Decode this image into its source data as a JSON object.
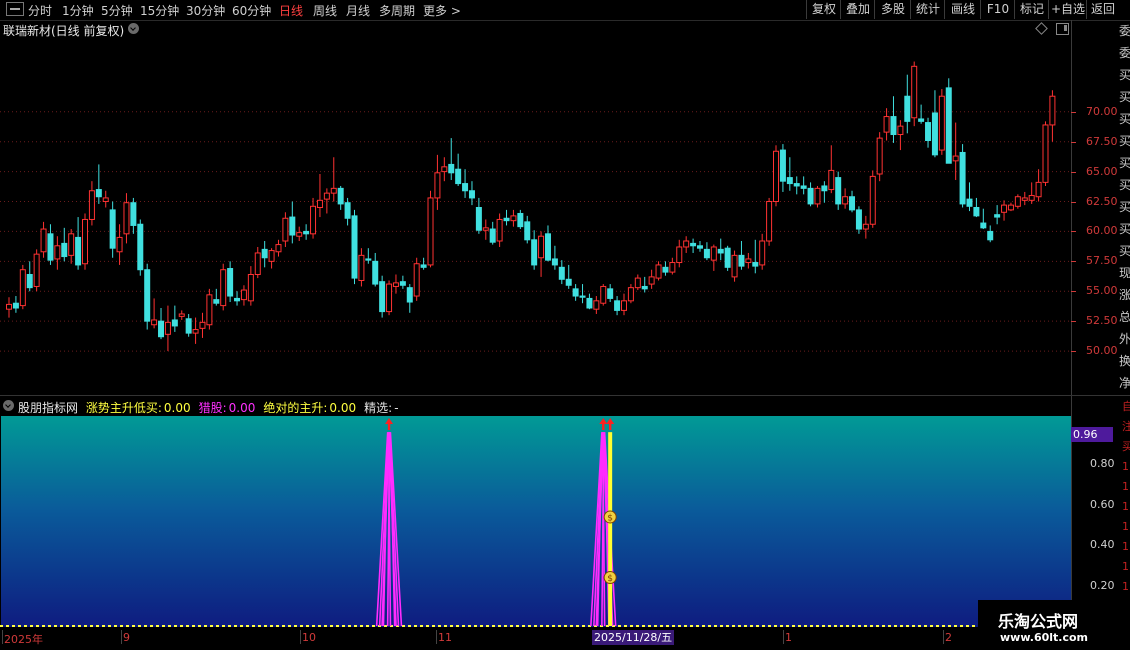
{
  "toolbar": {
    "periods": [
      "分时",
      "1分钟",
      "5分钟",
      "15分钟",
      "30分钟",
      "60分钟",
      "日线",
      "周线",
      "月线",
      "多周期",
      "更多 >"
    ],
    "active_period": "日线",
    "right_buttons": [
      "复权",
      "叠加",
      "多股",
      "统计",
      "画线",
      "F10",
      "标记",
      "+自选",
      "返回"
    ]
  },
  "stock": {
    "title": "联瑞新材(日线 前复权)"
  },
  "price_axis": {
    "labels": [
      "70.00",
      "67.50",
      "65.00",
      "62.50",
      "60.00",
      "57.50",
      "55.00",
      "52.50",
      "50.00"
    ]
  },
  "indicator": {
    "name": "股朋指标网",
    "fields": [
      {
        "label": "涨势主升低买:",
        "value": "0.00",
        "color": "#ffff40"
      },
      {
        "label": "猎股:",
        "value": "0.00",
        "color": "#ff30ff"
      },
      {
        "label": "绝对的主升:",
        "value": "0.00",
        "color": "#ffff40"
      },
      {
        "label": "精选:",
        "value": "-",
        "color": "#e0e0e0"
      }
    ],
    "axis_labels": [
      "0.80",
      "0.60",
      "0.40",
      "0.20"
    ],
    "current_value": "0.96"
  },
  "sidebar_chars": [
    "委",
    "委",
    "买",
    "买",
    "买",
    "买",
    "买",
    "买",
    "买",
    "买",
    "买",
    "现",
    "涨",
    "总",
    "外",
    "换",
    "净"
  ],
  "right_red_chars": [
    "自",
    "注",
    "买",
    "1",
    "1",
    "1",
    "1",
    "1",
    "1",
    "1"
  ],
  "x_axis": {
    "labels": [
      "2025年",
      "9",
      "10",
      "11",
      "1",
      "2"
    ],
    "current_date": "2025/11/28/五"
  },
  "watermark": {
    "line1": "乐淘公式网",
    "line2": "www.60lt.com"
  },
  "chart_data": {
    "type": "candlestick",
    "ylim": [
      48,
      76
    ],
    "up_color": "#ff3232",
    "down_color": "#40e0e0",
    "candles": [
      [
        53.5,
        54.5,
        52.8,
        53.9
      ],
      [
        54.0,
        54.6,
        53.2,
        53.6
      ],
      [
        53.8,
        57.2,
        53.5,
        56.8
      ],
      [
        56.4,
        57.5,
        55.0,
        55.3
      ],
      [
        55.4,
        58.5,
        55.0,
        58.1
      ],
      [
        58.3,
        60.8,
        57.8,
        60.2
      ],
      [
        59.8,
        60.6,
        57.2,
        57.6
      ],
      [
        57.7,
        59.6,
        56.8,
        58.8
      ],
      [
        59.0,
        60.3,
        57.5,
        57.9
      ],
      [
        58.0,
        60.2,
        57.3,
        59.8
      ],
      [
        59.5,
        61.2,
        56.8,
        57.2
      ],
      [
        57.3,
        61.5,
        56.8,
        61.0
      ],
      [
        61.0,
        64.2,
        60.5,
        63.4
      ],
      [
        63.5,
        65.6,
        62.3,
        62.9
      ],
      [
        62.5,
        63.4,
        62.0,
        62.8
      ],
      [
        61.8,
        62.5,
        57.8,
        58.6
      ],
      [
        58.3,
        60.6,
        57.2,
        59.5
      ],
      [
        59.8,
        63.2,
        59.0,
        62.4
      ],
      [
        62.4,
        62.8,
        59.8,
        60.5
      ],
      [
        60.6,
        61.0,
        56.3,
        56.8
      ],
      [
        56.8,
        57.3,
        51.8,
        52.5
      ],
      [
        52.2,
        54.4,
        51.9,
        52.6
      ],
      [
        52.5,
        53.6,
        51.0,
        51.2
      ],
      [
        51.4,
        53.8,
        50.0,
        52.4
      ],
      [
        52.6,
        53.8,
        51.6,
        52.1
      ],
      [
        52.9,
        53.4,
        52.6,
        53.1
      ],
      [
        52.7,
        53.1,
        51.2,
        51.5
      ],
      [
        51.5,
        52.8,
        50.6,
        51.8
      ],
      [
        51.9,
        53.2,
        51.1,
        52.4
      ],
      [
        52.2,
        55.2,
        51.8,
        54.7
      ],
      [
        54.3,
        55.2,
        53.8,
        54.0
      ],
      [
        53.8,
        57.3,
        53.4,
        56.8
      ],
      [
        56.9,
        57.5,
        54.1,
        54.6
      ],
      [
        54.4,
        55.0,
        53.8,
        54.2
      ],
      [
        54.3,
        55.5,
        53.8,
        55.1
      ],
      [
        54.2,
        57.1,
        53.8,
        56.4
      ],
      [
        56.4,
        58.7,
        56.1,
        58.2
      ],
      [
        58.5,
        59.2,
        57.0,
        57.8
      ],
      [
        57.5,
        58.6,
        56.9,
        58.4
      ],
      [
        58.3,
        59.3,
        57.9,
        58.9
      ],
      [
        59.2,
        61.6,
        58.7,
        61.1
      ],
      [
        61.2,
        62.5,
        59.0,
        59.7
      ],
      [
        59.6,
        60.4,
        59.2,
        59.9
      ],
      [
        60.0,
        60.6,
        59.3,
        59.8
      ],
      [
        59.8,
        62.8,
        59.4,
        62.1
      ],
      [
        62.0,
        64.8,
        61.2,
        62.6
      ],
      [
        62.7,
        63.6,
        61.5,
        63.2
      ],
      [
        63.2,
        66.2,
        62.5,
        63.6
      ],
      [
        63.6,
        63.8,
        61.8,
        62.3
      ],
      [
        62.4,
        62.8,
        60.5,
        61.1
      ],
      [
        61.3,
        61.8,
        55.6,
        56.1
      ],
      [
        55.9,
        58.6,
        55.4,
        58.0
      ],
      [
        57.7,
        58.6,
        57.3,
        57.6
      ],
      [
        57.5,
        58.2,
        55.4,
        55.6
      ],
      [
        55.8,
        56.3,
        52.8,
        53.3
      ],
      [
        53.3,
        55.9,
        53.0,
        55.6
      ],
      [
        55.4,
        56.4,
        54.8,
        55.7
      ],
      [
        55.8,
        56.3,
        55.2,
        55.5
      ],
      [
        55.3,
        55.6,
        53.2,
        54.1
      ],
      [
        54.6,
        57.8,
        54.2,
        57.3
      ],
      [
        57.2,
        57.8,
        56.8,
        57.0
      ],
      [
        57.2,
        63.4,
        57.0,
        62.8
      ],
      [
        62.8,
        66.4,
        61.8,
        64.9
      ],
      [
        65.0,
        66.2,
        64.2,
        65.4
      ],
      [
        65.6,
        67.8,
        64.3,
        64.9
      ],
      [
        65.2,
        66.5,
        63.8,
        64.0
      ],
      [
        64.0,
        65.2,
        62.8,
        63.4
      ],
      [
        63.4,
        64.2,
        62.2,
        62.8
      ],
      [
        62.0,
        62.8,
        59.8,
        60.1
      ],
      [
        60.1,
        61.0,
        59.3,
        60.3
      ],
      [
        60.2,
        60.8,
        58.9,
        59.1
      ],
      [
        59.2,
        61.5,
        58.7,
        61.0
      ],
      [
        61.1,
        61.8,
        60.5,
        60.9
      ],
      [
        60.9,
        61.8,
        60.4,
        61.3
      ],
      [
        61.5,
        61.8,
        60.2,
        60.4
      ],
      [
        60.8,
        61.3,
        59.0,
        59.3
      ],
      [
        59.3,
        60.1,
        56.8,
        57.2
      ],
      [
        57.8,
        60.0,
        56.2,
        59.6
      ],
      [
        59.8,
        60.5,
        57.5,
        57.6
      ],
      [
        57.7,
        58.8,
        56.8,
        57.2
      ],
      [
        57.0,
        57.6,
        55.6,
        56.0
      ],
      [
        56.0,
        57.2,
        55.2,
        55.5
      ],
      [
        55.2,
        55.6,
        54.2,
        54.6
      ],
      [
        54.6,
        55.6,
        54.0,
        54.5
      ],
      [
        54.4,
        54.8,
        53.5,
        53.6
      ],
      [
        53.5,
        54.6,
        53.1,
        54.2
      ],
      [
        54.0,
        55.6,
        53.8,
        55.4
      ],
      [
        55.2,
        55.6,
        54.1,
        54.4
      ],
      [
        54.2,
        54.6,
        53.0,
        53.4
      ],
      [
        53.4,
        54.8,
        53.0,
        54.2
      ],
      [
        54.2,
        55.6,
        54.0,
        55.3
      ],
      [
        55.3,
        56.4,
        55.1,
        56.1
      ],
      [
        55.4,
        56.2,
        54.9,
        55.2
      ],
      [
        55.6,
        56.8,
        55.2,
        56.2
      ],
      [
        56.1,
        57.5,
        55.9,
        57.2
      ],
      [
        57.0,
        57.5,
        56.3,
        56.6
      ],
      [
        56.6,
        57.8,
        56.4,
        57.4
      ],
      [
        57.4,
        59.3,
        57.0,
        58.7
      ],
      [
        58.7,
        59.6,
        58.2,
        59.2
      ],
      [
        59.0,
        59.4,
        58.2,
        58.8
      ],
      [
        58.8,
        59.2,
        58.3,
        58.6
      ],
      [
        58.5,
        59.1,
        57.6,
        57.8
      ],
      [
        57.6,
        58.9,
        56.7,
        58.7
      ],
      [
        58.5,
        59.4,
        57.6,
        58.2
      ],
      [
        58.6,
        58.8,
        56.7,
        57.0
      ],
      [
        56.2,
        58.4,
        55.8,
        58.0
      ],
      [
        58.0,
        59.2,
        56.8,
        57.1
      ],
      [
        57.4,
        58.2,
        56.9,
        57.7
      ],
      [
        57.4,
        59.3,
        56.5,
        57.1
      ],
      [
        57.2,
        59.8,
        56.8,
        59.2
      ],
      [
        59.2,
        62.8,
        58.8,
        62.5
      ],
      [
        62.5,
        67.2,
        62.1,
        66.7
      ],
      [
        66.8,
        67.3,
        63.3,
        64.2
      ],
      [
        64.5,
        66.2,
        63.4,
        64.0
      ],
      [
        64.0,
        64.6,
        63.1,
        63.8
      ],
      [
        63.8,
        64.6,
        63.1,
        63.6
      ],
      [
        63.6,
        64.1,
        62.1,
        62.3
      ],
      [
        62.3,
        63.8,
        62.0,
        63.6
      ],
      [
        63.8,
        64.2,
        62.4,
        63.4
      ],
      [
        63.5,
        67.2,
        63.2,
        65.1
      ],
      [
        64.5,
        65.0,
        61.8,
        62.3
      ],
      [
        62.3,
        63.6,
        61.9,
        62.9
      ],
      [
        62.9,
        63.4,
        61.6,
        61.8
      ],
      [
        61.8,
        62.1,
        59.8,
        60.2
      ],
      [
        60.2,
        61.3,
        59.4,
        60.6
      ],
      [
        60.6,
        65.1,
        60.3,
        64.6
      ],
      [
        64.8,
        68.3,
        64.2,
        67.8
      ],
      [
        68.3,
        70.3,
        67.6,
        69.6
      ],
      [
        69.6,
        71.3,
        67.4,
        68.1
      ],
      [
        68.1,
        69.3,
        66.8,
        68.8
      ],
      [
        71.3,
        73.1,
        68.2,
        69.2
      ],
      [
        69.5,
        74.2,
        68.8,
        73.8
      ],
      [
        69.4,
        70.6,
        69.0,
        69.2
      ],
      [
        69.1,
        69.5,
        67.0,
        67.6
      ],
      [
        69.9,
        71.8,
        66.2,
        66.4
      ],
      [
        66.8,
        71.9,
        66.4,
        71.3
      ],
      [
        72.0,
        72.8,
        66.2,
        65.7
      ],
      [
        65.9,
        69.1,
        64.3,
        66.3
      ],
      [
        66.6,
        67.3,
        62.0,
        62.3
      ],
      [
        62.7,
        64.1,
        61.7,
        62.1
      ],
      [
        62.0,
        62.8,
        61.2,
        61.3
      ],
      [
        60.7,
        61.9,
        60.2,
        60.3
      ],
      [
        60.0,
        60.5,
        59.1,
        59.3
      ],
      [
        61.4,
        62.2,
        60.6,
        61.2
      ],
      [
        61.6,
        62.6,
        60.9,
        62.2
      ],
      [
        61.8,
        62.4,
        61.7,
        62.2
      ],
      [
        62.1,
        63.1,
        61.9,
        62.9
      ],
      [
        62.6,
        63.3,
        62.2,
        62.8
      ],
      [
        62.6,
        64.1,
        62.3,
        63.0
      ],
      [
        62.9,
        65.2,
        62.5,
        64.1
      ],
      [
        64.1,
        69.2,
        63.8,
        68.9
      ],
      [
        68.9,
        71.8,
        67.5,
        71.3
      ]
    ]
  },
  "indicator_chart": {
    "ylim": [
      0,
      1.04
    ],
    "magenta_spikes": [
      {
        "candle": 55,
        "value": 0.96
      },
      {
        "candle": 86,
        "value": 0.96
      }
    ],
    "yellow_bars": [
      {
        "candle": 87,
        "value": 0.96
      }
    ],
    "up_arrows": [
      55,
      86,
      87
    ],
    "money_bag_markers": [
      {
        "candle": 87,
        "value": 0.54
      },
      {
        "candle": 87,
        "value": 0.24
      }
    ]
  }
}
